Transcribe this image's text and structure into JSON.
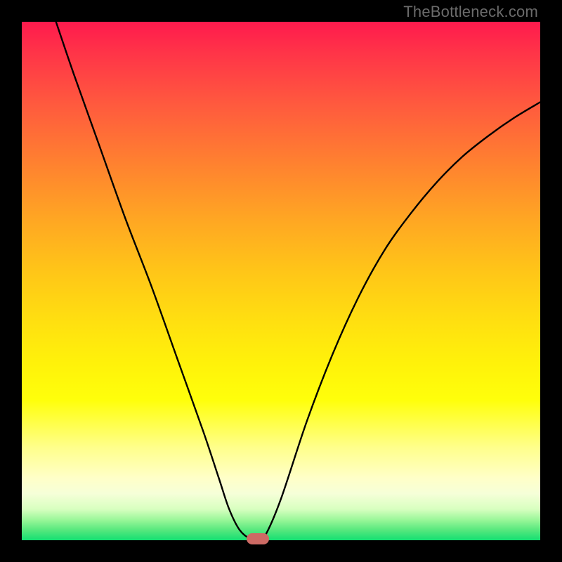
{
  "watermark": "TheBottleneck.com",
  "chart_data": {
    "type": "line",
    "title": "",
    "xlabel": "",
    "ylabel": "",
    "xlim": [
      0,
      1
    ],
    "ylim": [
      0,
      1
    ],
    "background_gradient": {
      "top": "#ff1a4d",
      "mid": "#ffe010",
      "bottom": "#14df72"
    },
    "series": [
      {
        "name": "curve",
        "x": [
          0.066,
          0.1,
          0.15,
          0.2,
          0.25,
          0.3,
          0.35,
          0.38,
          0.4,
          0.42,
          0.44,
          0.455,
          0.47,
          0.5,
          0.55,
          0.6,
          0.65,
          0.7,
          0.75,
          0.8,
          0.85,
          0.9,
          0.95,
          1.0
        ],
        "y": [
          1.0,
          0.9,
          0.76,
          0.62,
          0.49,
          0.35,
          0.21,
          0.12,
          0.06,
          0.02,
          0.003,
          0.0,
          0.01,
          0.08,
          0.23,
          0.36,
          0.47,
          0.56,
          0.63,
          0.69,
          0.74,
          0.78,
          0.815,
          0.845
        ]
      }
    ],
    "marker": {
      "x": 0.455,
      "y": 0.0,
      "color": "#cd6a64"
    }
  }
}
